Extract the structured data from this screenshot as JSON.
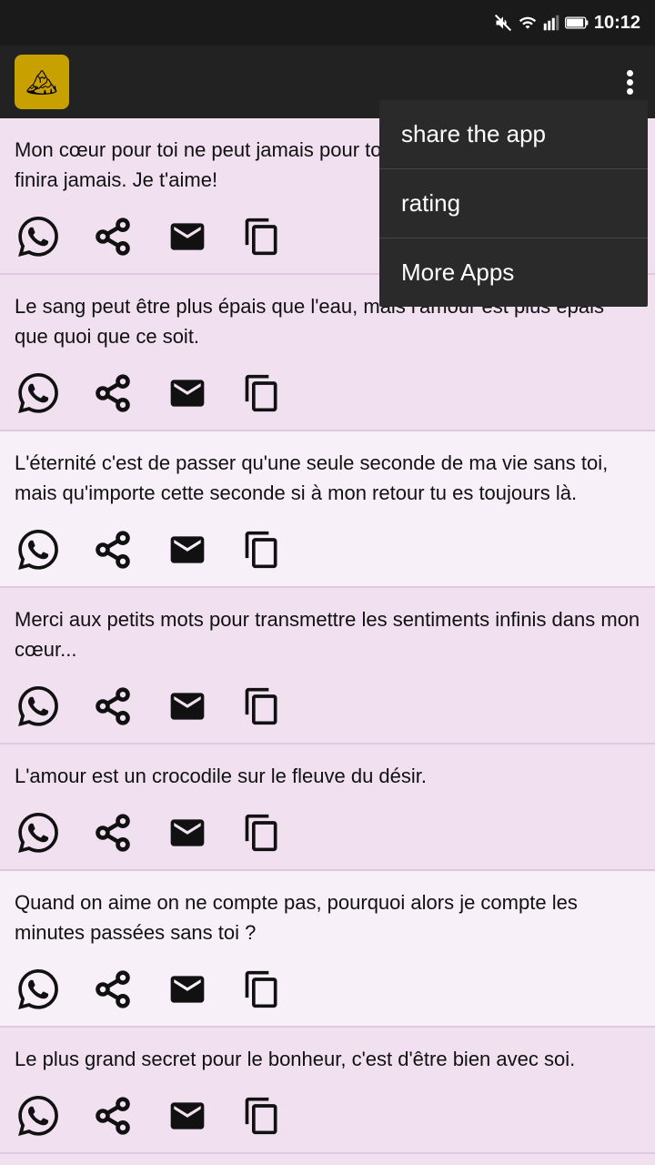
{
  "statusBar": {
    "time": "10:12"
  },
  "appBar": {
    "logo": "🏔",
    "menuDots": "⋮"
  },
  "dropdownMenu": {
    "items": [
      {
        "id": "share",
        "label": "share the app"
      },
      {
        "id": "rating",
        "label": "rating"
      },
      {
        "id": "more-apps",
        "label": "More Apps"
      }
    ]
  },
  "quotes": [
    {
      "id": 1,
      "text": "Mon cœur pour toi ne peut jamais pour toi ne s'effacera jamais. Mon finira jamais. Je t'aime!",
      "alt": false
    },
    {
      "id": 2,
      "text": "Le sang peut être plus épais que l'eau, mais l'amour est plus épais que quoi que ce soit.",
      "alt": false
    },
    {
      "id": 3,
      "text": "L'éternité c'est de passer qu'une seule seconde de ma vie sans toi, mais qu'importe cette seconde si à mon retour tu es toujours là.",
      "alt": true
    },
    {
      "id": 4,
      "text": "Merci aux petits mots pour transmettre les sentiments infinis dans mon cœur...",
      "alt": false
    },
    {
      "id": 5,
      "text": "L'amour est un crocodile sur le fleuve du désir.",
      "alt": false
    },
    {
      "id": 6,
      "text": "Quand on aime on ne compte pas, pourquoi alors je compte les minutes passées sans toi ?",
      "alt": true
    },
    {
      "id": 7,
      "text": "Le plus grand secret pour le bonheur, c'est d'être bien avec soi.",
      "alt": false
    }
  ]
}
